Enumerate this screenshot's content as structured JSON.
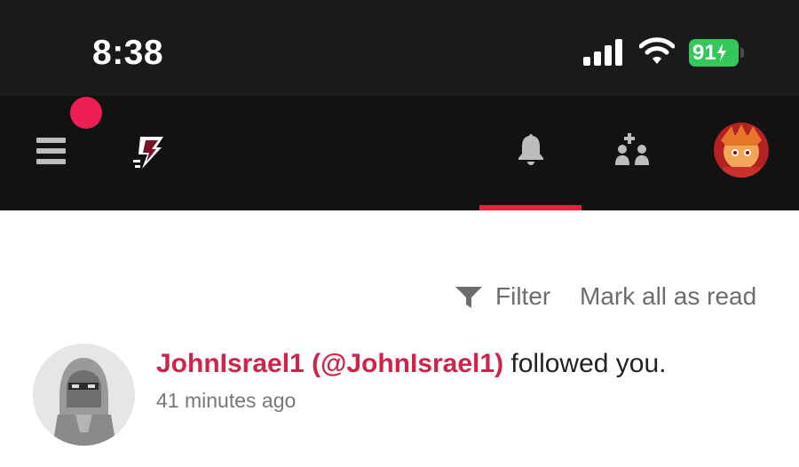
{
  "status_bar": {
    "time": "8:38",
    "battery": "91",
    "icons": [
      "signal-icon",
      "wifi-icon",
      "battery-icon"
    ]
  },
  "nav": {
    "icons": [
      "menu-icon",
      "logo-icon",
      "bell-icon",
      "people-add-icon",
      "user-avatar"
    ],
    "active_tab": "notifications",
    "accent": "#e5233f",
    "dot_color": "#ed1f52"
  },
  "toolbar": {
    "filter_label": "Filter",
    "mark_all_label": "Mark all as read"
  },
  "notifications": [
    {
      "user": "JohnIsrael1 (@JohnIsrael1)",
      "action": " followed you.",
      "time": "41 minutes ago"
    }
  ]
}
